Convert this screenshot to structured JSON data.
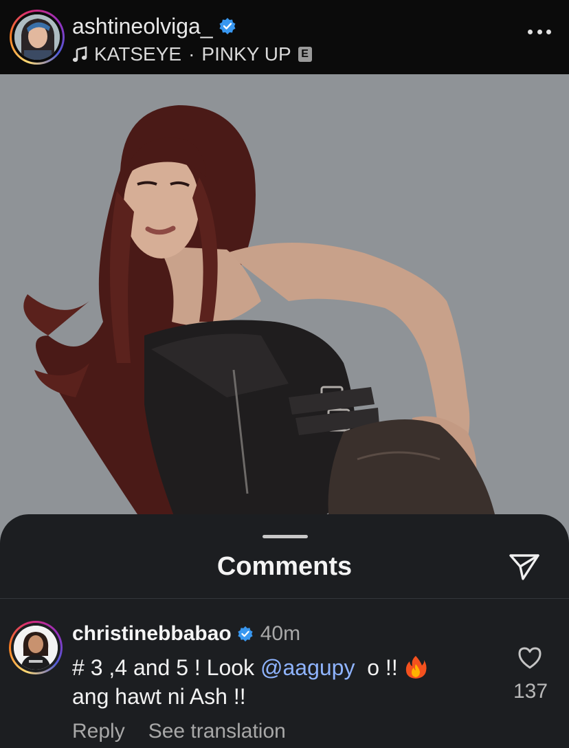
{
  "post": {
    "username": "ashtineolviga_",
    "verified": true,
    "music": {
      "artist": "KATSEYE",
      "separator": "·",
      "song": "PINKY UP",
      "explicit_badge": "E"
    },
    "more_icon": "ellipsis-horizontal-icon",
    "image_description": "portrait-photo"
  },
  "comments_sheet": {
    "title": "Comments",
    "share_icon": "paper-plane-icon",
    "comment": {
      "username": "christinebbabao",
      "verified": true,
      "time": "40m",
      "text_prefix": "# 3 ,4 and 5 ! Look ",
      "mention": "@aagupy",
      "text_mid": "  o !! ",
      "emoji": "fire-emoji",
      "text_line2": "ang hawt ni Ash !!",
      "reply_label": "Reply",
      "translation_label": "See translation",
      "like_count": "137",
      "like_icon": "heart-outline-icon"
    }
  },
  "colors": {
    "header_bg": "#0b0b0b",
    "sheet_bg": "#1c1e21",
    "verified_blue": "#3897f0",
    "mention_blue": "#8fb4ff",
    "photo_bg": "#8f9397"
  }
}
